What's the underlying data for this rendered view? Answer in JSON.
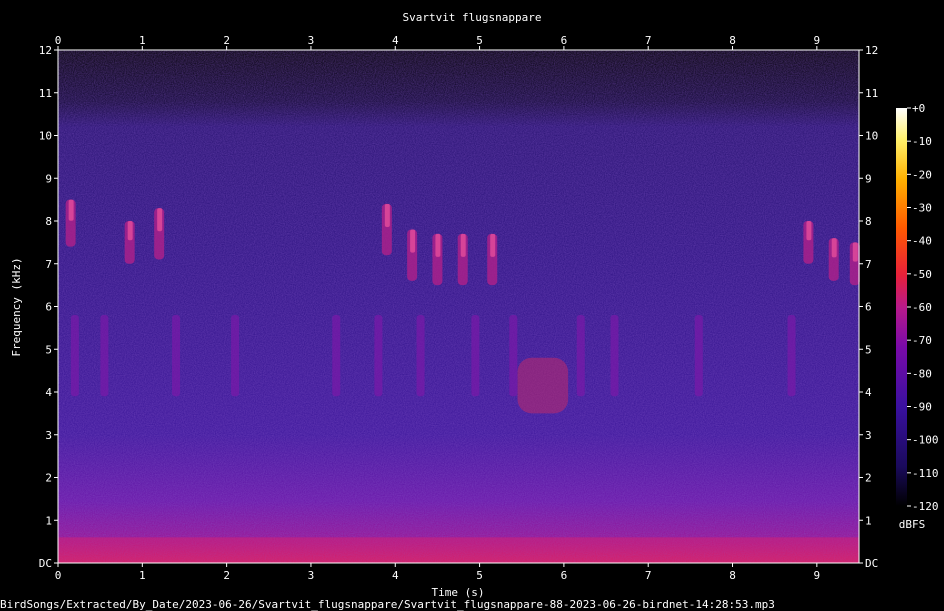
{
  "chart_data": {
    "type": "heatmap",
    "title": "Svartvit flugsnappare",
    "xlabel": "Time (s)",
    "ylabel": "Frequency (kHz)",
    "xlim": [
      0,
      9.5
    ],
    "ylim": [
      0,
      12
    ],
    "x_ticks": [
      "0",
      "1",
      "2",
      "3",
      "4",
      "5",
      "6",
      "7",
      "8",
      "9"
    ],
    "y_ticks": [
      "DC",
      "1",
      "2",
      "3",
      "4",
      "5",
      "6",
      "7",
      "8",
      "9",
      "10",
      "11",
      "12"
    ],
    "colorbar": {
      "label": "dBFS",
      "range": [
        -120,
        0
      ],
      "ticks": [
        "+0",
        "-10",
        "-20",
        "-30",
        "-40",
        "-50",
        "-60",
        "-70",
        "-80",
        "-90",
        "-100",
        "-110",
        "-120"
      ],
      "colors": [
        "#000000",
        "#1a0a5c",
        "#3a10a0",
        "#7a0aa8",
        "#b81a8a",
        "#e8203a",
        "#ff5a00",
        "#ffb000",
        "#fff06a",
        "#ffffff"
      ]
    },
    "footer": "BirdSongs/Extracted/By_Date/2023-06-26/Svartvit_flugsnappare/Svartvit_flugsnappare-88-2023-06-26-birdnet-14:28:53.mp3"
  }
}
